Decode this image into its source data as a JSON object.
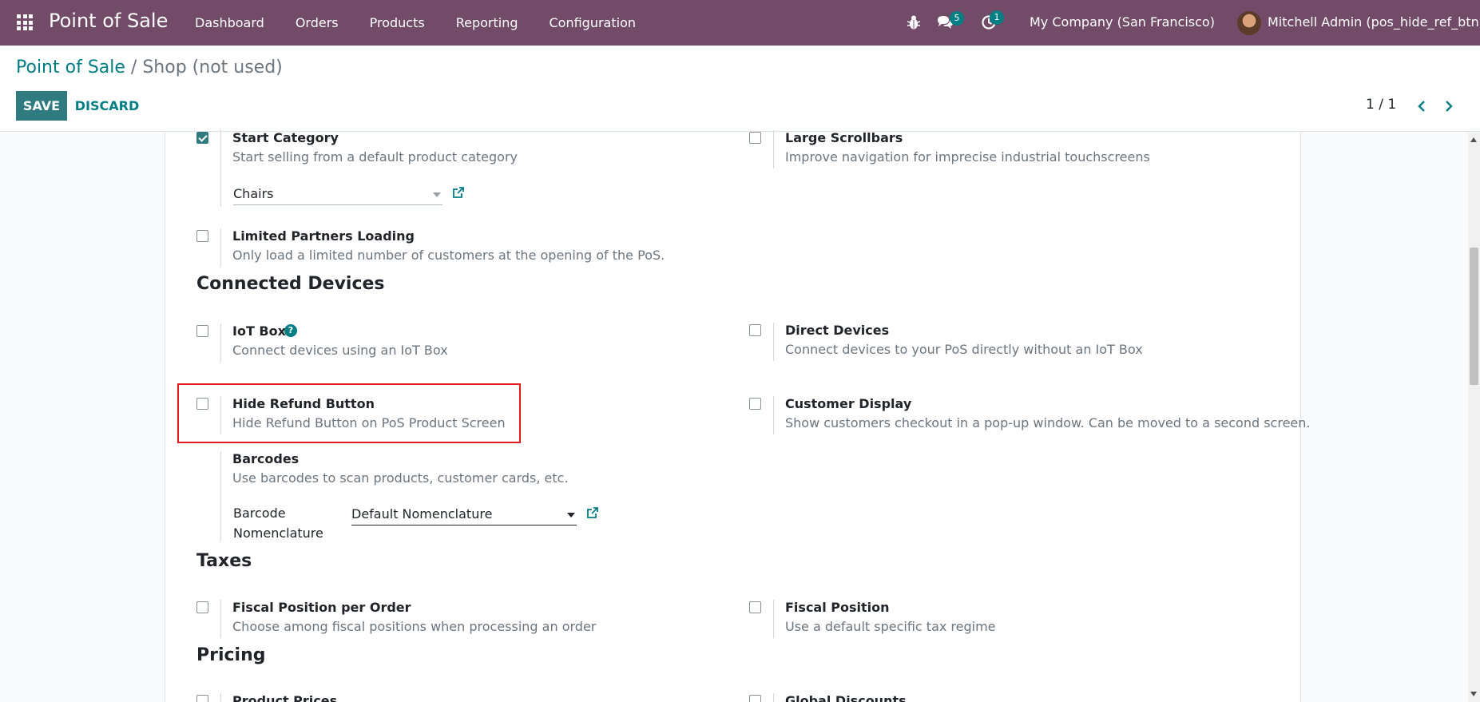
{
  "navbar": {
    "brand": "Point of Sale",
    "menu": [
      "Dashboard",
      "Orders",
      "Products",
      "Reporting",
      "Configuration"
    ],
    "messages_count": "5",
    "activities_count": "1",
    "company": "My Company (San Francisco)",
    "user": "Mitchell Admin (pos_hide_ref_btn)"
  },
  "breadcrumb": {
    "parent": "Point of Sale",
    "separator": "/",
    "current": "Shop (not used)"
  },
  "actions": {
    "save_label": "SAVE",
    "discard_label": "DISCARD"
  },
  "pager": {
    "value": "1 / 1"
  },
  "settings": {
    "start_category": {
      "title": "Start Category",
      "desc": "Start selling from a default product category",
      "checked": true,
      "field_value": "Chairs"
    },
    "large_scrollbars": {
      "title": "Large Scrollbars",
      "desc": "Improve navigation for imprecise industrial touchscreens",
      "checked": false
    },
    "limited_partners": {
      "title": "Limited Partners Loading",
      "desc": "Only load a limited number of customers at the opening of the PoS.",
      "checked": false
    },
    "iot_box": {
      "title": "IoT Box",
      "desc": "Connect devices using an IoT Box",
      "checked": false
    },
    "direct_devices": {
      "title": "Direct Devices",
      "desc": "Connect devices to your PoS directly without an IoT Box",
      "checked": false
    },
    "hide_refund": {
      "title": "Hide Refund Button",
      "desc": "Hide Refund Button on PoS Product Screen",
      "checked": false
    },
    "customer_display": {
      "title": "Customer Display",
      "desc": "Show customers checkout in a pop-up window. Can be moved to a second screen.",
      "checked": false
    },
    "barcodes": {
      "title": "Barcodes",
      "desc": "Use barcodes to scan products, customer cards, etc.",
      "field_label_line1": "Barcode",
      "field_label_line2": "Nomenclature",
      "field_value": "Default Nomenclature"
    },
    "fiscal_position_per_order": {
      "title": "Fiscal Position per Order",
      "desc": "Choose among fiscal positions when processing an order",
      "checked": false
    },
    "fiscal_position": {
      "title": "Fiscal Position",
      "desc": "Use a default specific tax regime",
      "checked": false
    },
    "product_prices": {
      "title": "Product Prices",
      "checked": false
    },
    "global_discounts": {
      "title": "Global Discounts",
      "checked": false
    }
  },
  "sections": {
    "connected_devices": "Connected Devices",
    "taxes": "Taxes",
    "pricing": "Pricing"
  },
  "help_glyph": "?",
  "colors": {
    "navbar": "#714b67",
    "accent": "#017e84",
    "primary_button": "#2f7b7f",
    "highlight": "#e11d1d"
  }
}
